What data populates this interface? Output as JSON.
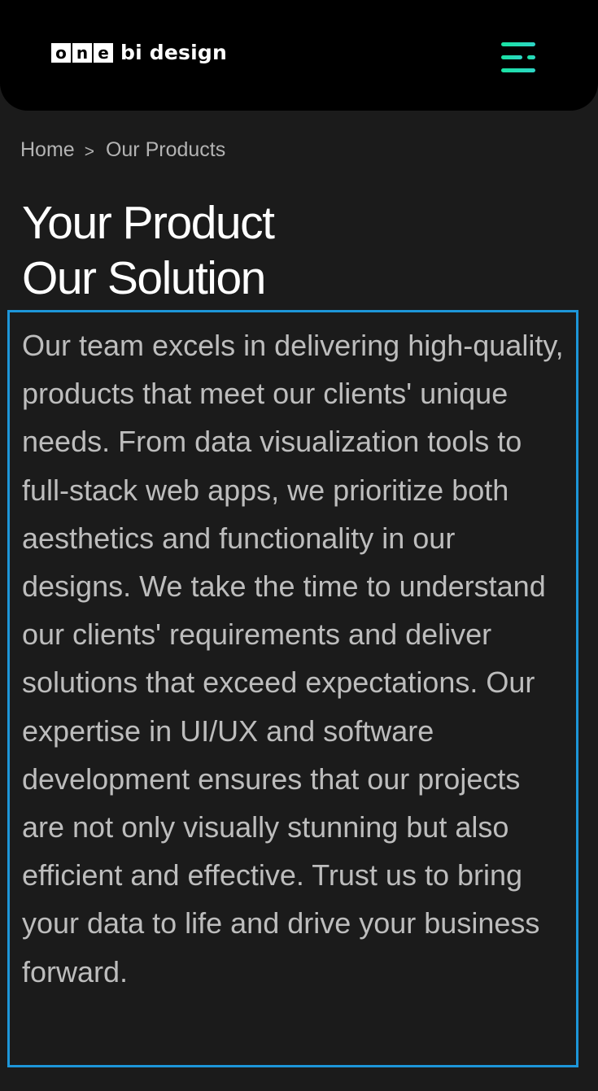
{
  "header": {
    "logo": {
      "boxed_letters": [
        "o",
        "n",
        "e"
      ],
      "text": "bi design"
    },
    "menu_icon": "hamburger-menu-icon",
    "accent_color": "#1de2aa"
  },
  "breadcrumb": {
    "home": "Home",
    "separator": ">",
    "current": "Our Products"
  },
  "hero": {
    "title_line1": "Your Product",
    "title_line2": "Our Solution",
    "description": "Our team excels in delivering high-quality, products that meet our clients' unique needs. From data visualization tools to full-stack web apps, we prioritize both aesthetics and functionality in our designs. We take the time to understand our clients' requirements and deliver solutions that exceed expectations. Our expertise in UI/UX and software development ensures that our projects are not only visually stunning but also efficient and effective. Trust us to bring your data to life and drive your business forward."
  },
  "highlight_color": "#1d96d9"
}
